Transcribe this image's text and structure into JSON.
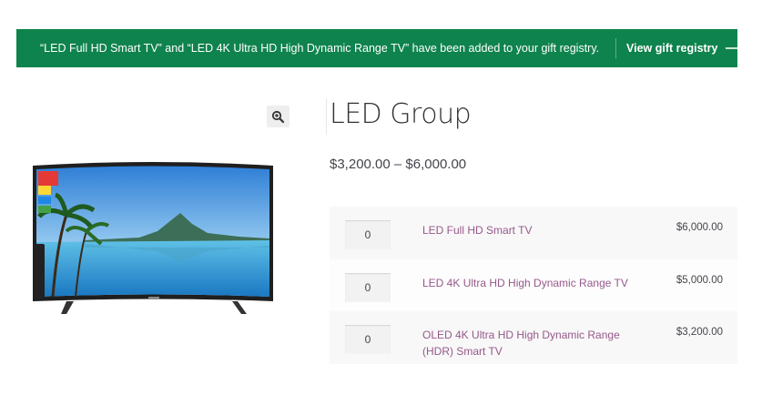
{
  "notice": {
    "message": "“LED Full HD Smart TV” and “LED 4K Ultra HD High Dynamic Range TV” have been added to your gift registry.",
    "link_label": "View gift registry",
    "arrow": "⟶",
    "color": "#0f834d"
  },
  "gallery": {
    "zoom_icon": "zoom-in-icon",
    "image_alt": "LED TV"
  },
  "product": {
    "title": "LED Group",
    "price_range": "$3,200.00 – $6,000.00"
  },
  "grouped_items": [
    {
      "qty": "0",
      "name": "LED Full HD Smart TV",
      "price": "$6,000.00"
    },
    {
      "qty": "0",
      "name": "LED 4K Ultra HD High Dynamic Range TV",
      "price": "$5,000.00"
    },
    {
      "qty": "0",
      "name": "OLED 4K Ultra HD High Dynamic Range (HDR) Smart TV",
      "price": "$3,200.00"
    }
  ],
  "colors": {
    "link": "#96588a",
    "text": "#43454b"
  }
}
